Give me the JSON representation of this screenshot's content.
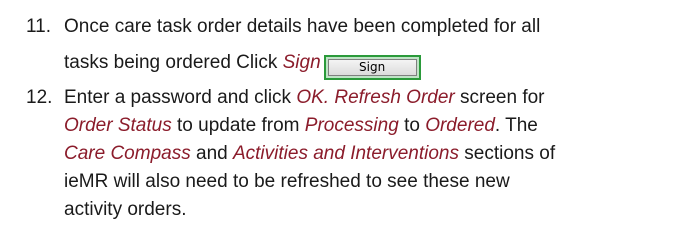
{
  "steps": [
    {
      "number": "11.",
      "line1": "Once care task order details have been completed for all",
      "line2_text": "tasks being ordered Click ",
      "line2_em": "Sign",
      "button_label": "Sign"
    },
    {
      "number": "12.",
      "l1_t1": "Enter a password and click ",
      "l1_e1": "OK. Refresh Order",
      "l1_t2": " screen for",
      "l2_e1": "Order Status",
      "l2_t1": " to update from ",
      "l2_e2": "Processing",
      "l2_t2": " to ",
      "l2_e3": "Ordered",
      "l2_t3": ".  The",
      "l3_e1": "Care Compass",
      "l3_t1": " and ",
      "l3_e2": "Activities and Interventions",
      "l3_t2": " sections of",
      "l4": "ieMR will also need to be refreshed to see these new",
      "l5": "activity orders."
    }
  ]
}
